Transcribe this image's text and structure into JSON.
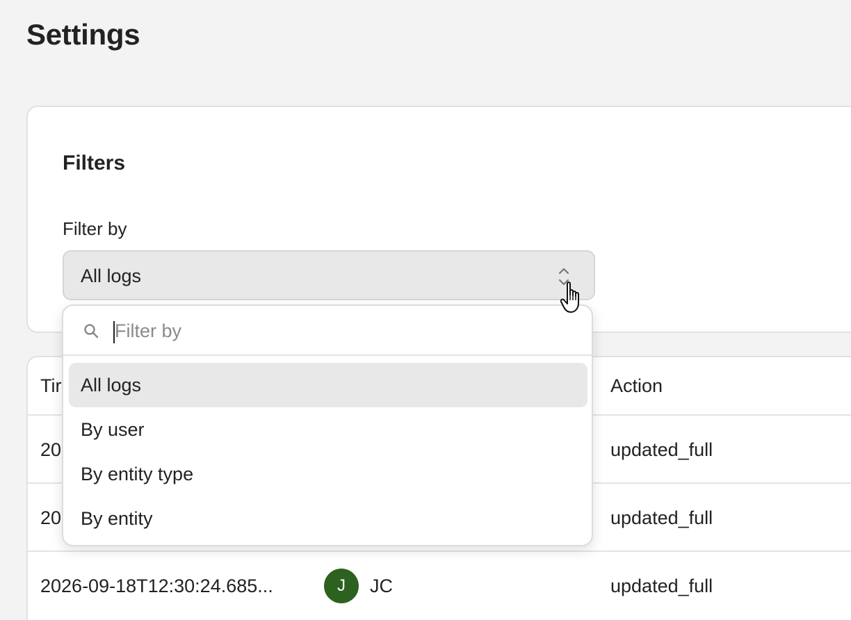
{
  "page": {
    "title": "Settings"
  },
  "filters": {
    "heading": "Filters",
    "filter_label": "Filter by",
    "select_value": "All logs"
  },
  "dropdown": {
    "search_placeholder": "Filter by",
    "options": [
      {
        "label": "All logs",
        "selected": true
      },
      {
        "label": "By user",
        "selected": false
      },
      {
        "label": "By entity type",
        "selected": false
      },
      {
        "label": "By entity",
        "selected": false
      }
    ]
  },
  "table": {
    "headers": {
      "time": "Tir",
      "action": "Action"
    },
    "rows": [
      {
        "time": "20",
        "action": "updated_full"
      },
      {
        "time": "20",
        "action": "updated_full"
      },
      {
        "time": "2026-09-18T12:30:24.685...",
        "avatar_initial": "J",
        "user": "JC",
        "action": "updated_full"
      }
    ]
  },
  "colors": {
    "background": "#f3f3f3",
    "avatar": "#2d6120",
    "selected_option": "#e8e8e8"
  },
  "icons": [
    "search-icon",
    "chevron-up-down-icon",
    "hand-pointer-cursor-icon"
  ]
}
